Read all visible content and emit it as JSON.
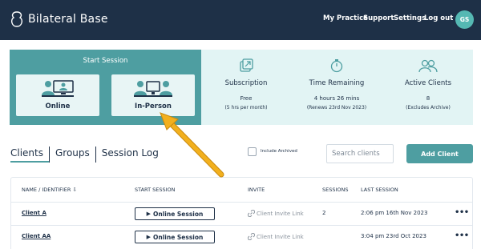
{
  "app": {
    "name": "Bilateral Base"
  },
  "nav": {
    "my_practice": "My Practice",
    "support": "Support",
    "settings": "Settings",
    "logout": "Log out",
    "avatar_initials": "GS"
  },
  "start_session": {
    "title": "Start Session",
    "online_label": "Online",
    "in_person_label": "In-Person"
  },
  "stats": {
    "subscription": {
      "title": "Subscription",
      "value": "Free",
      "note": "(5 hrs per month)"
    },
    "time_remaining": {
      "title": "Time Remaining",
      "value": "4 hours 26 mins",
      "note": "(Renews 23rd Nov 2023)"
    },
    "active_clients": {
      "title": "Active Clients",
      "value": "8",
      "note": "(Excludes Archive)"
    }
  },
  "tabs": {
    "clients": "Clients",
    "groups": "Groups",
    "session_log": "Session Log"
  },
  "filters": {
    "include_archived": "Include Archived",
    "search_placeholder": "Search clients",
    "add_client": "Add Client"
  },
  "table": {
    "headers": {
      "name": "NAME / IDENTIFIER",
      "sort_icon": "⇩",
      "start_session": "START SESSION",
      "invite": "INVITE",
      "sessions": "SESSIONS",
      "last_session": "LAST SESSION"
    },
    "rows": [
      {
        "name": "Client A",
        "action": "Online Session",
        "invite": "Client Invite Link",
        "sessions": "2",
        "last_session": "2:06 pm 16th Nov 2023",
        "more": "•••"
      },
      {
        "name": "Client AA",
        "action": "Online Session",
        "invite": "Client Invite Link",
        "sessions": "",
        "last_session": "3:04 pm 23rd Oct 2023",
        "more": "•••"
      }
    ]
  },
  "colors": {
    "header_bg": "#1e3047",
    "teal": "#4e9ea1",
    "panel_bg": "#e2f4f4",
    "annotation_arrow": "#f2b01e"
  }
}
